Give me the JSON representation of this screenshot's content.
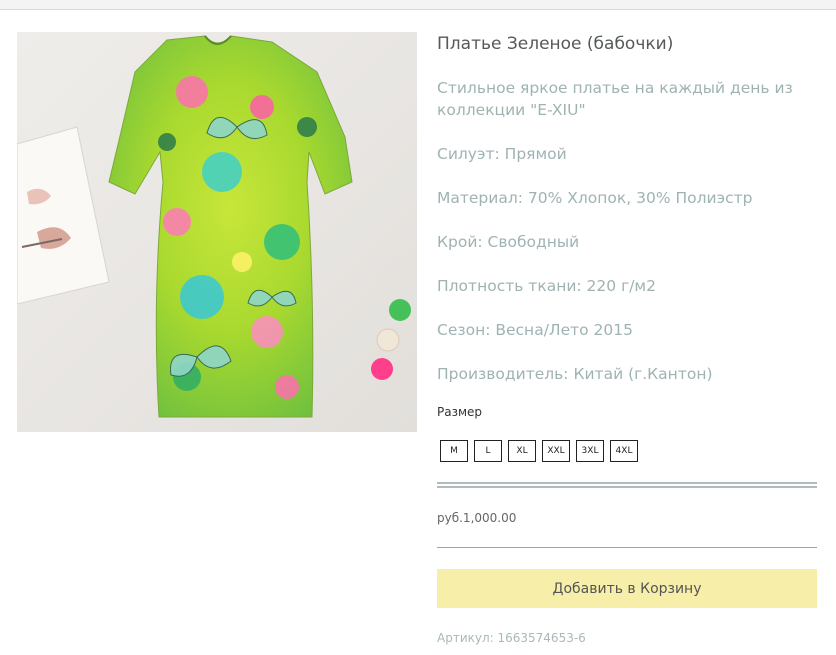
{
  "top_strip": {
    "fragment": "...у ... ... ... ... ... ..."
  },
  "product": {
    "image_alt": "green butterfly print dress",
    "title": "Платье Зеленое (бабочки)",
    "description": "Стильное яркое платье на каждый день из коллекции \"E-XIU\"",
    "attributes": [
      "Силуэт: Прямой",
      "Материал: 70% Хлопок, 30% Полиэстр",
      "Крой: Свободный",
      "Плотность ткани: 220 г/м2",
      "Сезон: Весна/Лето 2015",
      "Производитель: Китай (г.Кантон)"
    ],
    "size_label": "Размер",
    "sizes": [
      "M",
      "L",
      "XL",
      "XXL",
      "3XL",
      "4XL"
    ],
    "price": "руб.1,000.00",
    "add_to_cart": "Добавить в Корзину",
    "sku": "Артикул: 1663574653-6"
  },
  "colors": {
    "title": "#55595a",
    "description": "#9fb3b3",
    "button_bg": "#f7eeaa",
    "rule": "#aebcbc",
    "sku": "#a9b9b9"
  }
}
